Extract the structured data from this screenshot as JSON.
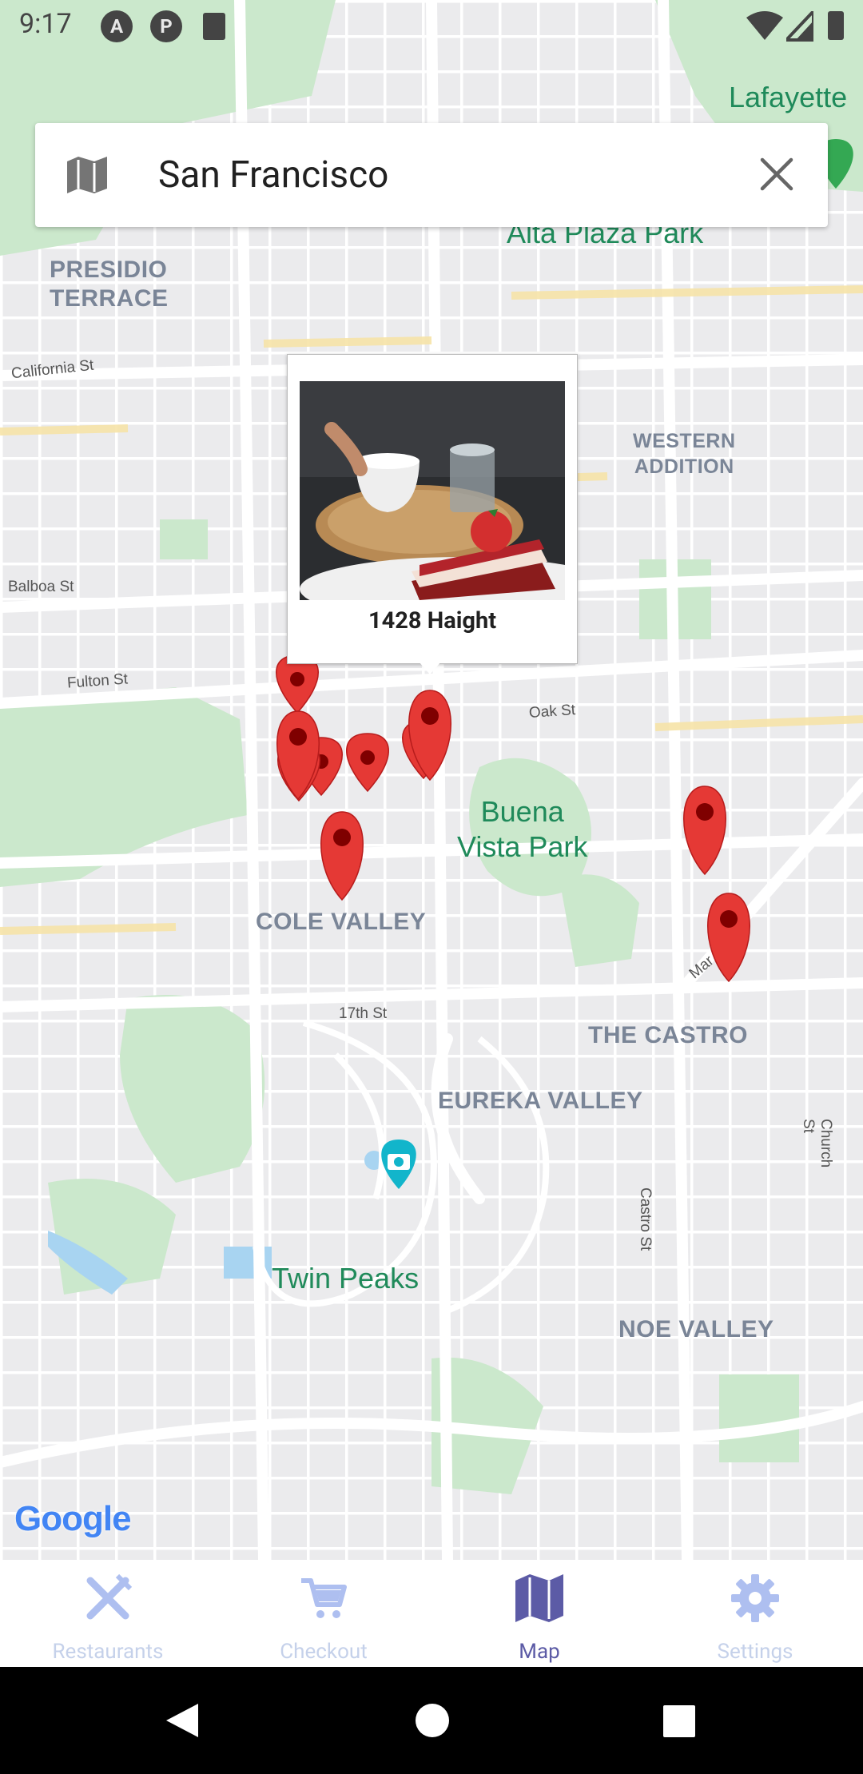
{
  "status_bar": {
    "time": "9:17",
    "indicator_letters": [
      "A",
      "P"
    ]
  },
  "search": {
    "value": "San Francisco"
  },
  "map": {
    "area_labels": [
      "PRESIDIO\nTERRACE",
      "WESTERN\nADDITION",
      "COLE VALLEY",
      "THE CASTRO",
      "EUREKA VALLEY",
      "NOE VALLEY"
    ],
    "park_labels": [
      "Lafayette",
      "Alta Plaza Park",
      "Buena\nVista Park",
      "Twin Peaks"
    ],
    "street_labels": [
      "California St",
      "Balboa St",
      "Fulton St",
      "Oak St",
      "17th St",
      "Castro St",
      "Church St",
      "Mar"
    ],
    "attribution": "Google"
  },
  "popup": {
    "title": "1428 Haight"
  },
  "bottom_nav": {
    "items": [
      {
        "label": "Restaurants",
        "icon": "fork-knife-icon",
        "active": false
      },
      {
        "label": "Checkout",
        "icon": "cart-icon",
        "active": false
      },
      {
        "label": "Map",
        "icon": "map-icon",
        "active": true
      },
      {
        "label": "Settings",
        "icon": "gear-icon",
        "active": false
      }
    ]
  },
  "colors": {
    "nav_active": "#5c5ba6",
    "nav_inactive": "#c5d1ea",
    "nav_icon_inactive": "#aebff0",
    "marker": "#e53935",
    "park": "#c8e6c9",
    "map_bg": "#eeeeee"
  }
}
